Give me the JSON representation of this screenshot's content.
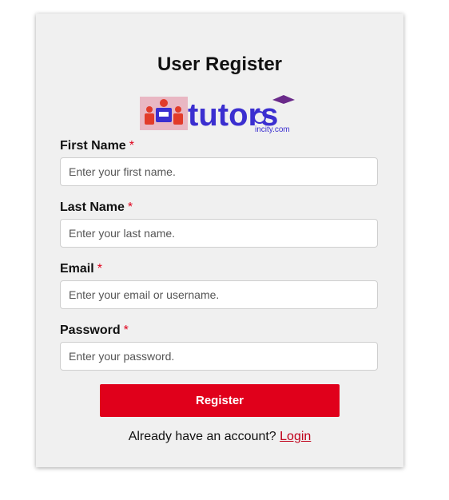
{
  "form": {
    "title": "User Register",
    "logo_text_main": "tutors",
    "logo_text_sub": "incity.com",
    "required_mark": "*",
    "fields": [
      {
        "label": "First Name",
        "placeholder": "Enter your first name."
      },
      {
        "label": "Last Name",
        "placeholder": "Enter your last name."
      },
      {
        "label": "Email",
        "placeholder": "Enter your email or username."
      },
      {
        "label": "Password",
        "placeholder": "Enter your password."
      }
    ],
    "submit_label": "Register",
    "footer_text": "Already have an account?",
    "login_link": "Login"
  },
  "colors": {
    "accent": "#e0001b",
    "logo_blue": "#3b2fd0",
    "card_bg": "#f0f0f0"
  }
}
